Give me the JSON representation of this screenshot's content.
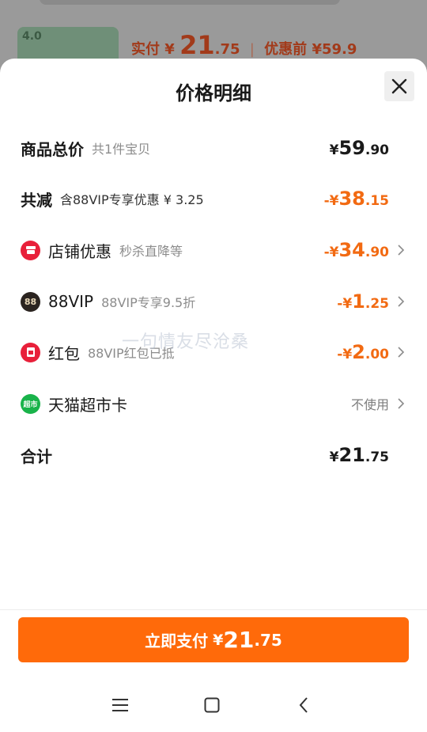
{
  "background": {
    "price_prefix": "实付",
    "currency": "¥",
    "price_int": "21",
    "price_dec": ".75",
    "before_label": "优惠前",
    "before_price": "¥59.9"
  },
  "sheet": {
    "title": "价格明细",
    "watermark": "一句情友尽沧桑"
  },
  "rows": {
    "total": {
      "label": "商品总价",
      "sub": "共1件宝贝",
      "cur": "¥",
      "int": "59",
      "dec": ".90"
    },
    "reduce": {
      "label": "共减",
      "sub": "含88VIP专享优惠 ¥ 3.25",
      "cur": "-¥",
      "int": "38",
      "dec": ".15"
    },
    "shop": {
      "label": "店铺优惠",
      "sub": "秒杀直降等",
      "cur": "-¥",
      "int": "34",
      "dec": ".90"
    },
    "vip": {
      "label": "88VIP",
      "sub": "88VIP专享9.5折",
      "cur": "-¥",
      "int": "1",
      "dec": ".25",
      "icon_text": "88"
    },
    "redpack": {
      "label": "红包",
      "sub": "88VIP红包已抵",
      "cur": "-¥",
      "int": "2",
      "dec": ".00"
    },
    "tmall_card": {
      "label": "天猫超市卡",
      "value": "不使用",
      "icon_text": "超市"
    },
    "sum": {
      "label": "合计",
      "cur": "¥",
      "int": "21",
      "dec": ".75"
    }
  },
  "pay_button": {
    "label": "立即支付",
    "cur": "¥",
    "int": "21",
    "dec": ".75"
  },
  "colors": {
    "accent": "#ff6a0a",
    "discount": "#f26a12",
    "shop_icon": "#e8203a",
    "vip_icon": "#2b2420",
    "tmall_icon": "#19b34a"
  }
}
